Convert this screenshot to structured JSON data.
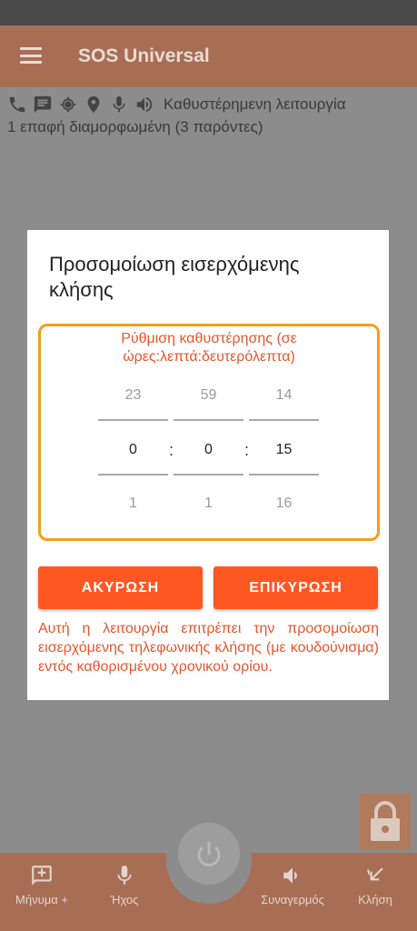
{
  "app": {
    "title": "SOS Universal"
  },
  "status": {
    "mode_text": "Καθυστέρημενη λειτουργία",
    "contacts_text": "1 επαφή διαμορφωμένη (3 παρόντες)",
    "icons": [
      "phone-icon",
      "message-icon",
      "gps-icon",
      "location-pin-icon",
      "mic-icon",
      "volume-icon"
    ]
  },
  "dialog": {
    "title": "Προσομοίωση εισερχόμενης κλήσης",
    "delay_label": "Ρύθμιση καθυστέρησης (σε ώρες:λεπτά:δευτερόλεπτα)",
    "separator": ":",
    "pickers": {
      "hours": {
        "prev": "23",
        "current": "0",
        "next": "1"
      },
      "minutes": {
        "prev": "59",
        "current": "0",
        "next": "1"
      },
      "seconds": {
        "prev": "14",
        "current": "15",
        "next": "16"
      }
    },
    "cancel_label": "ΑΚΥΡΩΣΗ",
    "confirm_label": "ΕΠΙΚΥΡΩΣΗ",
    "note": "Αυτή η λειτουργία επιτρέπει την προσομοίωση εισερχόμενης τηλεφωνικής κλήσης (με κουδούνισμα) εντός καθορισμένου χρονικού ορίου."
  },
  "bottom_nav": {
    "message_label": "Μήνυμα +",
    "audio_label": "Ήχος",
    "alarm_label": "Συναγερμός",
    "call_label": "Κλήση"
  },
  "colors": {
    "accent": "#ff5722",
    "box_border": "#f0a01a",
    "app_bar_dimmed": "#a76e55"
  }
}
